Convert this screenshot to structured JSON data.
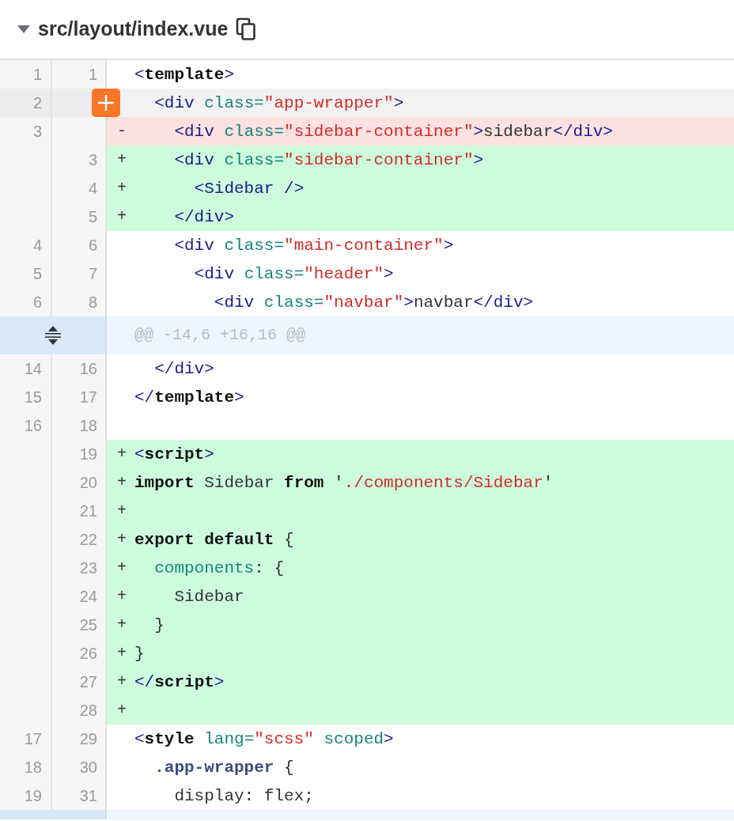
{
  "file": {
    "path": "src/layout/index.vue",
    "expanded": true
  },
  "rows": [
    {
      "kind": "context",
      "old": "1",
      "new": "1",
      "tokens": [
        {
          "kind": "tag",
          "text": "<"
        },
        {
          "kind": "tagb",
          "text": "template"
        },
        {
          "kind": "tag",
          "text": ">"
        }
      ]
    },
    {
      "kind": "context",
      "old": "2",
      "hovered": true,
      "tokens": [
        {
          "kind": "tag",
          "text": "  <div"
        },
        {
          "kind": "attr",
          "text": " class="
        },
        {
          "kind": "str",
          "text": "\"app-wrapper\""
        },
        {
          "kind": "tag",
          "text": ">"
        }
      ]
    },
    {
      "kind": "del",
      "old": "3",
      "sign": "-",
      "tokens": [
        {
          "kind": "tag",
          "text": "    <div"
        },
        {
          "kind": "attr",
          "text": " class="
        },
        {
          "kind": "str",
          "text": "\"sidebar-container\""
        },
        {
          "kind": "tag",
          "text": ">"
        },
        {
          "kind": "plain",
          "text": "sidebar"
        },
        {
          "kind": "tag",
          "text": "</div>"
        }
      ]
    },
    {
      "kind": "add",
      "new": "3",
      "sign": "+",
      "tokens": [
        {
          "kind": "tag",
          "text": "    <div"
        },
        {
          "kind": "attr",
          "text": " class="
        },
        {
          "kind": "str",
          "text": "\"sidebar-container\""
        },
        {
          "kind": "tag",
          "text": ">"
        }
      ]
    },
    {
      "kind": "add",
      "new": "4",
      "sign": "+",
      "tokens": [
        {
          "kind": "tag",
          "text": "      <Sidebar />"
        }
      ]
    },
    {
      "kind": "add",
      "new": "5",
      "sign": "+",
      "tokens": [
        {
          "kind": "tag",
          "text": "    </div>"
        }
      ]
    },
    {
      "kind": "context",
      "old": "4",
      "new": "6",
      "tokens": [
        {
          "kind": "tag",
          "text": "    <div"
        },
        {
          "kind": "attr",
          "text": " class="
        },
        {
          "kind": "str",
          "text": "\"main-container\""
        },
        {
          "kind": "tag",
          "text": ">"
        }
      ]
    },
    {
      "kind": "context",
      "old": "5",
      "new": "7",
      "tokens": [
        {
          "kind": "tag",
          "text": "      <div"
        },
        {
          "kind": "attr",
          "text": " class="
        },
        {
          "kind": "str",
          "text": "\"header\""
        },
        {
          "kind": "tag",
          "text": ">"
        }
      ]
    },
    {
      "kind": "context",
      "old": "6",
      "new": "8",
      "tokens": [
        {
          "kind": "tag",
          "text": "        <div"
        },
        {
          "kind": "attr",
          "text": " class="
        },
        {
          "kind": "str",
          "text": "\"navbar\""
        },
        {
          "kind": "tag",
          "text": ">"
        },
        {
          "kind": "plain",
          "text": "navbar"
        },
        {
          "kind": "tag",
          "text": "</div>"
        }
      ]
    },
    {
      "kind": "hunk",
      "header": "@@ -14,6 +16,16 @@"
    },
    {
      "kind": "context",
      "old": "14",
      "new": "16",
      "tokens": [
        {
          "kind": "tag",
          "text": "  </div>"
        }
      ]
    },
    {
      "kind": "context",
      "old": "15",
      "new": "17",
      "tokens": [
        {
          "kind": "tag",
          "text": "</"
        },
        {
          "kind": "tagb",
          "text": "template"
        },
        {
          "kind": "tag",
          "text": ">"
        }
      ]
    },
    {
      "kind": "context",
      "old": "16",
      "new": "18",
      "tokens": []
    },
    {
      "kind": "add",
      "new": "19",
      "sign": "+",
      "tokens": [
        {
          "kind": "tag",
          "text": "<"
        },
        {
          "kind": "tagb",
          "text": "script"
        },
        {
          "kind": "tag",
          "text": ">"
        }
      ]
    },
    {
      "kind": "add",
      "new": "20",
      "sign": "+",
      "tokens": [
        {
          "kind": "kw",
          "text": "import"
        },
        {
          "kind": "plain",
          "text": " Sidebar "
        },
        {
          "kind": "kw",
          "text": "from"
        },
        {
          "kind": "plain",
          "text": " '"
        },
        {
          "kind": "str",
          "text": "./components/Sidebar"
        },
        {
          "kind": "plain",
          "text": "'"
        }
      ]
    },
    {
      "kind": "add",
      "new": "21",
      "sign": "+",
      "tokens": []
    },
    {
      "kind": "add",
      "new": "22",
      "sign": "+",
      "tokens": [
        {
          "kind": "kw",
          "text": "export default"
        },
        {
          "kind": "plain",
          "text": " {"
        }
      ]
    },
    {
      "kind": "add",
      "new": "23",
      "sign": "+",
      "tokens": [
        {
          "kind": "attr",
          "text": "  components"
        },
        {
          "kind": "plain",
          "text": ": {"
        }
      ]
    },
    {
      "kind": "add",
      "new": "24",
      "sign": "+",
      "tokens": [
        {
          "kind": "plain",
          "text": "    Sidebar"
        }
      ]
    },
    {
      "kind": "add",
      "new": "25",
      "sign": "+",
      "tokens": [
        {
          "kind": "plain",
          "text": "  }"
        }
      ]
    },
    {
      "kind": "add",
      "new": "26",
      "sign": "+",
      "tokens": [
        {
          "kind": "plain",
          "text": "}"
        }
      ]
    },
    {
      "kind": "add",
      "new": "27",
      "sign": "+",
      "tokens": [
        {
          "kind": "tag",
          "text": "</"
        },
        {
          "kind": "tagb",
          "text": "script"
        },
        {
          "kind": "tag",
          "text": ">"
        }
      ]
    },
    {
      "kind": "add",
      "new": "28",
      "sign": "+",
      "tokens": []
    },
    {
      "kind": "context",
      "old": "17",
      "new": "29",
      "tokens": [
        {
          "kind": "tag",
          "text": "<"
        },
        {
          "kind": "tagb",
          "text": "style"
        },
        {
          "kind": "attr",
          "text": " lang="
        },
        {
          "kind": "str",
          "text": "\"scss\""
        },
        {
          "kind": "attr",
          "text": " scoped"
        },
        {
          "kind": "tag",
          "text": ">"
        }
      ]
    },
    {
      "kind": "context",
      "old": "18",
      "new": "30",
      "tokens": [
        {
          "kind": "sel",
          "text": "  .app-wrapper"
        },
        {
          "kind": "plain",
          "text": " {"
        }
      ]
    },
    {
      "kind": "context",
      "old": "19",
      "new": "31",
      "tokens": [
        {
          "kind": "plain",
          "text": "    display: flex;"
        }
      ]
    },
    {
      "kind": "hunk"
    }
  ]
}
